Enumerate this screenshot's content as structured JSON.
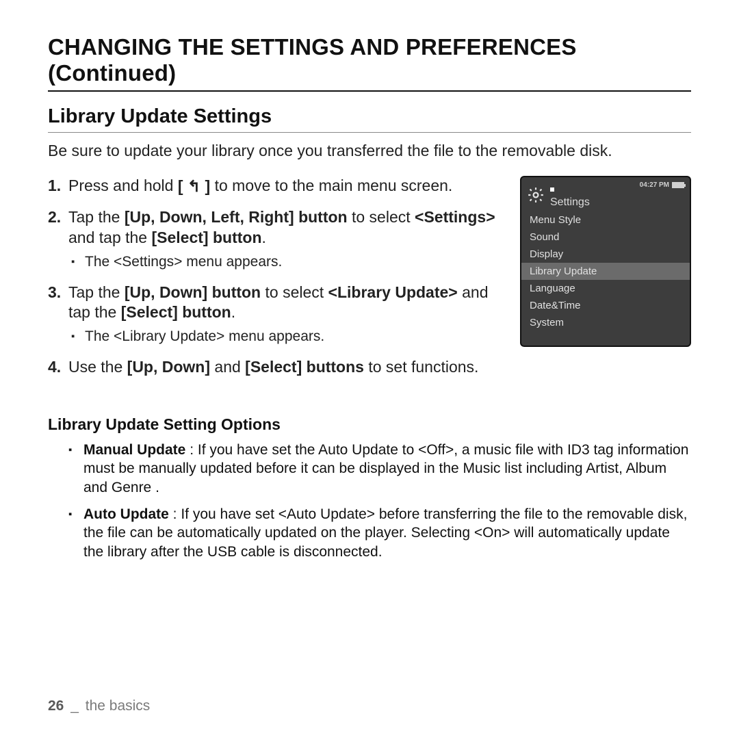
{
  "chapter_title": "CHANGING THE SETTINGS AND PREFERENCES (Continued)",
  "section_title": "Library Update Settings",
  "intro": "Be sure to update your library once you transferred the file to the removable disk.",
  "steps": {
    "s1_pre": "Press and hold ",
    "s1_key": "[ ↰ ]",
    "s1_post": " to move to the main menu screen.",
    "s2_pre": "Tap the ",
    "s2_b1": "[Up, Down, Left, Right] button",
    "s2_mid": " to select ",
    "s2_b2": "<Settings>",
    "s2_mid2": " and tap the ",
    "s2_b3": "[Select] button",
    "s2_end": ".",
    "s2_sub": "The <Settings> menu appears.",
    "s3_pre": "Tap the ",
    "s3_b1": "[Up, Down] button",
    "s3_mid": " to select ",
    "s3_b2": "<Library Update>",
    "s3_mid2": " and tap the ",
    "s3_b3": "[Select] button",
    "s3_end": ".",
    "s3_sub": "The <Library Update> menu appears.",
    "s4_pre": "Use the ",
    "s4_b1": "[Up, Down]",
    "s4_mid": " and ",
    "s4_b2": "[Select] buttons",
    "s4_post": " to set functions."
  },
  "options_title": "Library Update Setting Options",
  "options": {
    "o1_b": "Manual Update",
    "o1_rest": " : If you have set the Auto Update to <Off>, a music file with ID3 tag information must be manually updated before it can be displayed in the Music list including Artist, Album and Genre .",
    "o2_b": "Auto Update",
    "o2_rest": " : If you have set <Auto Update> before transferring the file to the removable disk, the file can be automatically updated on the player. Selecting <On> will automatically update the library after the USB cable is disconnected."
  },
  "device": {
    "time": "04:27 PM",
    "title": "Settings",
    "menu": [
      "Menu Style",
      "Sound",
      "Display",
      "Library Update",
      "Language",
      "Date&Time",
      "System"
    ],
    "selected_index": 3
  },
  "footer": {
    "page": "26",
    "sep": "_",
    "section": "the basics"
  }
}
